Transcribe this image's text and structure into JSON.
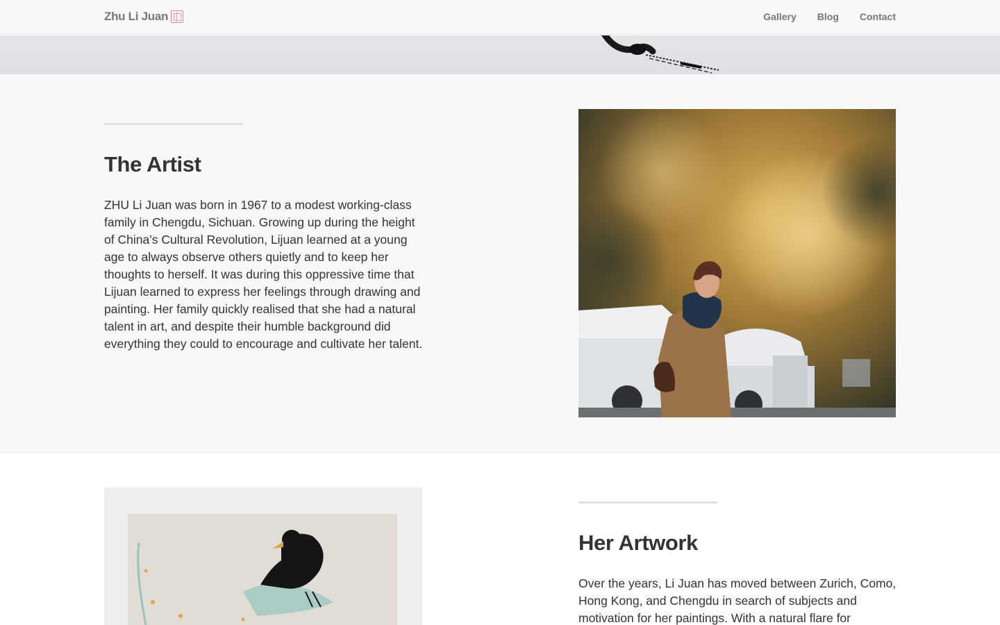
{
  "navbar": {
    "brand": "Zhu Li Juan",
    "brand_seal_icon": "seal-stamp-icon",
    "links": [
      "Gallery",
      "Blog",
      "Contact"
    ]
  },
  "artist": {
    "heading": "The Artist",
    "text": "ZHU Li Juan was born in 1967 to a modest working-class family in Chengdu, Sichuan. Growing up during the height of China’s Cultural Revolution, Lijuan learned at a young age to always observe others quietly and to keep her thoughts to herself. It was during this oppressive time that Lijuan learned to express her feelings through drawing and painting. Her family quickly realised that she had a natural talent in art, and despite their humble background did everything they could to encourage and cultivate her talent."
  },
  "artwork": {
    "heading": "Her Artwork",
    "text": "Over the years, Li Juan has moved between Zurich, Como, Hong Kong, and Chengdu in search of subjects and motivation for her paintings. With a natural flare for"
  },
  "colors": {
    "navbar_bg": "#f8f8f8",
    "section_bg": "#f8f8f8",
    "nav_text": "#777777",
    "heading_text": "#333333",
    "seal_red": "#d98a8a"
  }
}
